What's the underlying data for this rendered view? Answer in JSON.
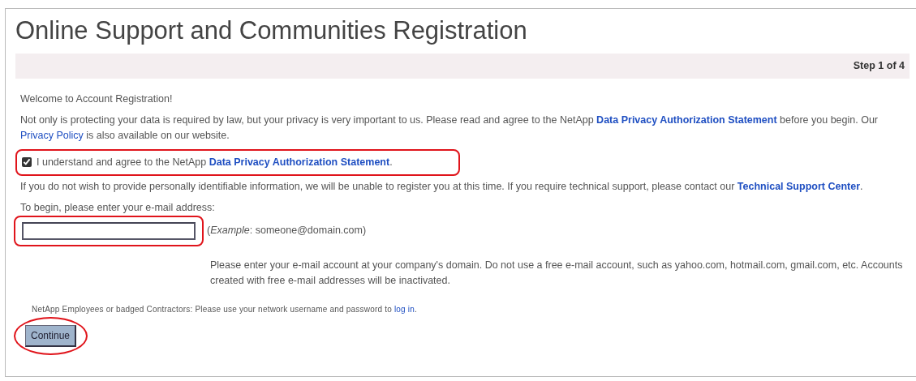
{
  "title": "Online Support and Communities Registration",
  "step": "Step 1 of 4",
  "welcome": "Welcome to Account Registration!",
  "privacy_paragraph": [
    {
      "kind": "text",
      "text": "Not only is protecting your data is required by law, but your privacy is very important to us. Please read and agree to the NetApp "
    },
    {
      "kind": "link",
      "text": "Data Privacy Authorization Statement",
      "bold": true
    },
    {
      "kind": "text",
      "text": " before you begin. Our "
    },
    {
      "kind": "link",
      "text": "Privacy Policy",
      "bold": false
    },
    {
      "kind": "text",
      "text": " is also available on our website."
    }
  ],
  "agreement": {
    "checked": true,
    "highlighted": true,
    "parts": [
      {
        "kind": "text",
        "text": "I understand and agree to the NetApp "
      },
      {
        "kind": "link",
        "text": "Data Privacy Authorization Statement",
        "bold": true
      },
      {
        "kind": "text",
        "text": "."
      }
    ]
  },
  "support_paragraph": [
    {
      "kind": "text",
      "text": "If you do not wish to provide personally identifiable information, we will be unable to register you at this time. If you require technical support, please contact our "
    },
    {
      "kind": "link",
      "text": "Technical Support Center",
      "bold": true
    },
    {
      "kind": "text",
      "text": "."
    }
  ],
  "email_prompt": "To begin, please enter your e-mail address:",
  "email_field": {
    "highlighted": true
  },
  "email_example": "(*Example*: someone@domain.com)",
  "email_note": "Please enter your e-mail account at your company's domain. Do not use a free e-mail account, such as yahoo.com, hotmail.com, gmail.com, etc. Accounts created with free e-mail addresses will be inactivated.",
  "employee_note": [
    {
      "kind": "text",
      "text": "NetApp Employees or badged Contractors: Please use your network username and password to "
    },
    {
      "kind": "link",
      "text": "log in",
      "bold": false
    },
    {
      "kind": "text",
      "text": "."
    }
  ],
  "continue_button": {
    "label": "Continue",
    "highlighted": true
  }
}
